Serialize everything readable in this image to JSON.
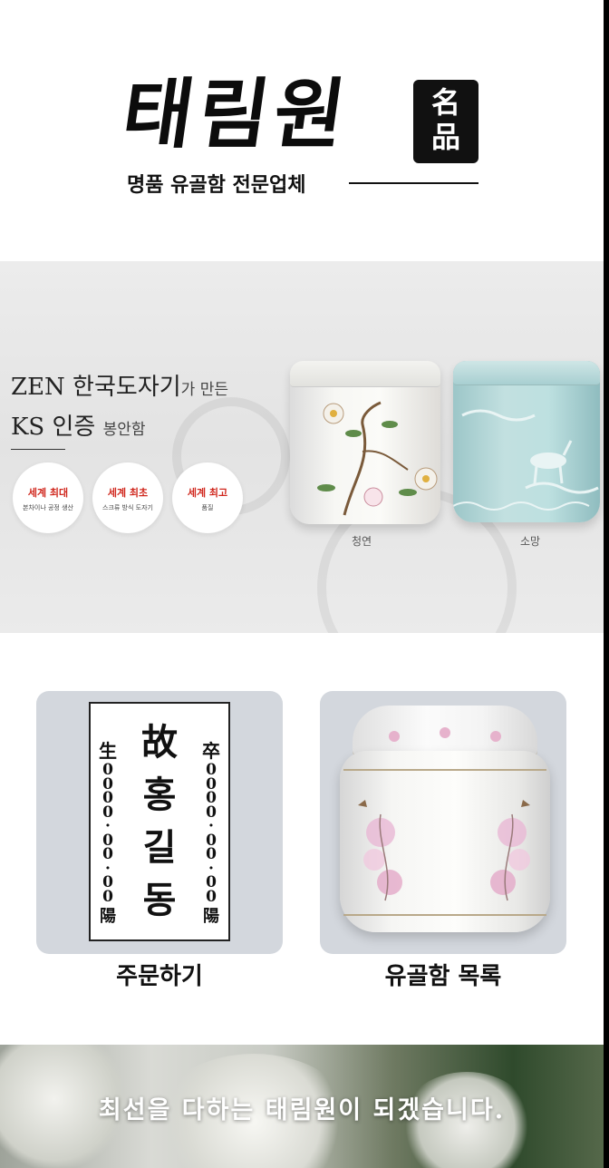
{
  "header": {
    "brand": "태림원",
    "seal": "名品",
    "tagline": "명품 유골함 전문업체"
  },
  "banner": {
    "line1_main": "ZEN 한국도자기",
    "line1_sub": "가 만든",
    "line2_main": "KS 인증",
    "line2_sub": "봉안함",
    "badges": [
      {
        "title": "세계 최대",
        "sub": "본차이나 공정 생산"
      },
      {
        "title": "세계 최초",
        "sub": "스크류 방식 도자기"
      },
      {
        "title": "세계 최고",
        "sub": "품질"
      }
    ],
    "products": [
      {
        "name": "청연"
      },
      {
        "name": "소망"
      }
    ]
  },
  "cards": [
    {
      "title": "주문하기"
    },
    {
      "title": "유골함 목록"
    }
  ],
  "plaque": {
    "left_top": "生",
    "left_digits": [
      "0",
      "0",
      "0",
      "0",
      "·",
      "0",
      "0",
      "·",
      "0",
      "0"
    ],
    "left_bottom": "陽",
    "center": [
      "故",
      "홍",
      "길",
      "동"
    ],
    "right_top": "卒",
    "right_digits": [
      "0",
      "0",
      "0",
      "0",
      "·",
      "0",
      "0",
      "·",
      "0",
      "0"
    ],
    "right_bottom": "陽"
  },
  "footer": {
    "slogan": "최선을 다하는 태림원이 되겠습니다."
  }
}
